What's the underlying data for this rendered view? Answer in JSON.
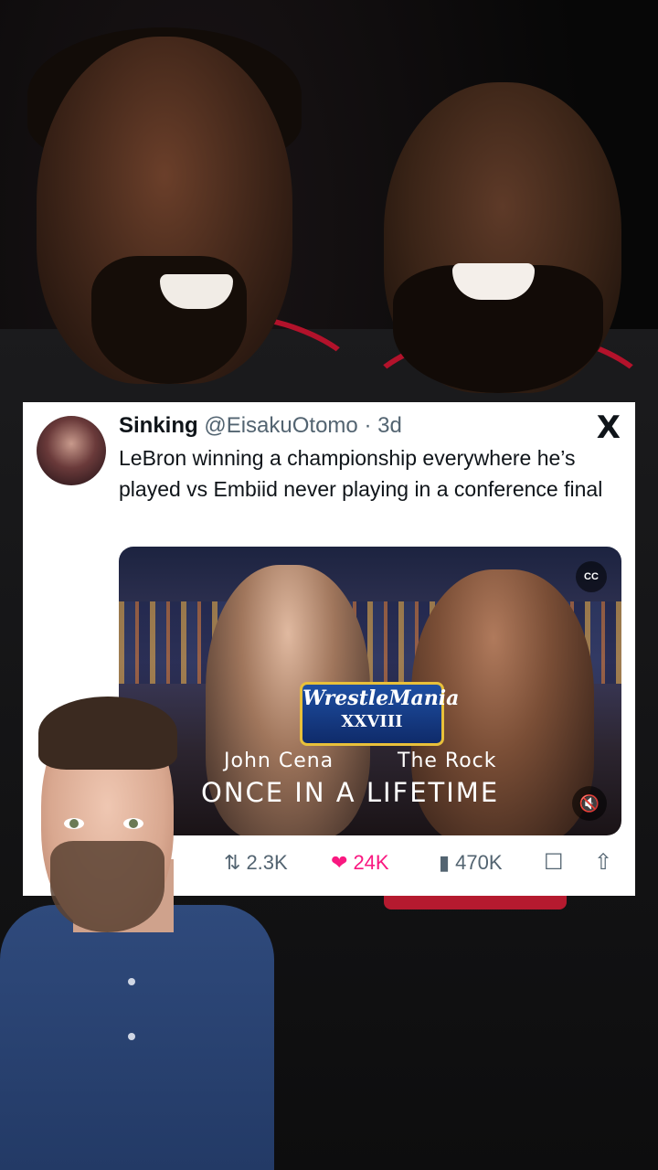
{
  "tweet": {
    "display_name": "Sinking",
    "handle": "@EisakuOtomo",
    "time": "· 3d",
    "platform_logo": "X",
    "text": "LeBron winning a championship everywhere he’s played vs Embiid never playing in a conference final",
    "media": {
      "logo_line1": "WrestleMania",
      "logo_line2": "XXVIII",
      "caption_left": "John Cena",
      "caption_right": "The Rock",
      "tagline": "ONCE IN A LIFETIME",
      "cc_label": "CC",
      "mute_icon": "speaker-muted-icon"
    },
    "actions": {
      "reposts": "2.3K",
      "likes": "24K",
      "views": "470K",
      "like_color": "#f91880"
    }
  },
  "background": {
    "jersey_accent": "#b3122b"
  }
}
